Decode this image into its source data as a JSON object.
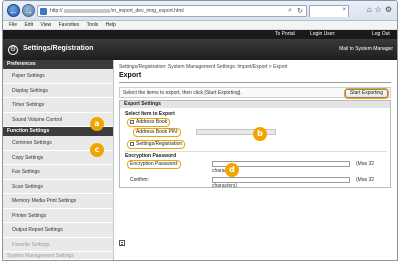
{
  "browser": {
    "url_prefix": "http://",
    "url_suffix": "/m_import_dev_imrg_export.html",
    "menu": [
      "File",
      "Edit",
      "View",
      "Favorites",
      "Tools",
      "Help"
    ]
  },
  "app": {
    "to_portal": "To Portal",
    "login_user": "Login User:",
    "log_out": "Log Out",
    "title": "Settings/Registration",
    "mail_link": "Mail to System Manager"
  },
  "sidebar": {
    "preferences_heading": "Preferences",
    "preferences": [
      "Paper Settings",
      "Display Settings",
      "Timer Settings",
      "Sound Volume Control"
    ],
    "function_heading": "Function Settings",
    "functions": [
      "Common Settings",
      "Copy Settings",
      "Fax Settings",
      "Scan Settings",
      "Memory Media Print Settings",
      "Printer Settings",
      "Output Report Settings",
      "Favorite Settings"
    ],
    "bottom": "System Management Settings"
  },
  "main": {
    "breadcrumb": "Settings/Registration: System Management Settings: Import/Export > Export",
    "heading": "Export",
    "intro": "Select the items to export, then click [Start Exporting].",
    "start_button": "Start Exporting",
    "panel_title": "Export Settings",
    "select_label": "Select Item to Export",
    "address_book": "Address Book",
    "address_book_pin": "Address Book PIN:",
    "settings_registration": "Settings/Registration",
    "encryption_heading": "Encryption Password",
    "encryption_password": "Encryption Password:",
    "confirm": "Confirm:",
    "max32": "(Max 32",
    "characters": "characters)"
  },
  "callouts": [
    "a",
    "b",
    "c",
    "d"
  ],
  "colors": {
    "callout": "#f0a500",
    "header": "#1e1e1e",
    "sidebar": "#e9e9e9"
  }
}
